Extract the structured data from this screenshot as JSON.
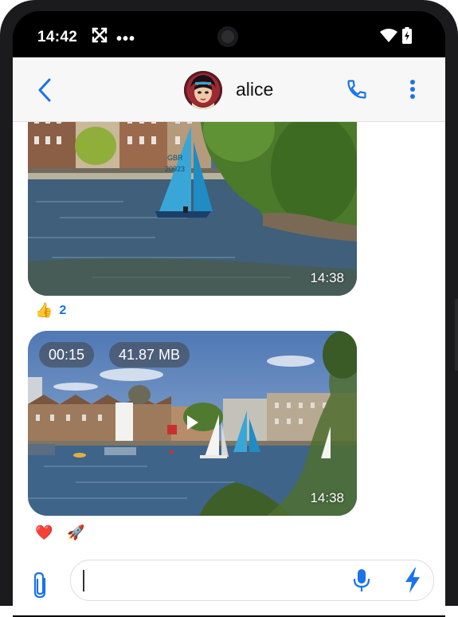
{
  "status_bar": {
    "time": "14:42",
    "dots": "•••",
    "icons": [
      "crossed-arrows-icon",
      "wifi-icon",
      "battery-charging-icon"
    ]
  },
  "header": {
    "contact_name": "alice",
    "icons": [
      "back-arrow-icon",
      "avatar",
      "phone-icon",
      "more-vertical-icon"
    ]
  },
  "messages": [
    {
      "type": "photo",
      "time": "14:38",
      "reaction": {
        "emoji": "👍",
        "count": "2"
      }
    },
    {
      "type": "video",
      "duration": "00:15",
      "size": "41.87 MB",
      "time": "14:38",
      "reactions": [
        "❤️",
        "🚀"
      ]
    }
  ],
  "composer": {
    "placeholder": "",
    "icons": [
      "paperclip-icon",
      "microphone-icon",
      "lightning-icon"
    ]
  },
  "colors": {
    "accent": "#1a73e8",
    "header_bg": "#f7f7f8",
    "status_bar_bg": "#000000"
  }
}
